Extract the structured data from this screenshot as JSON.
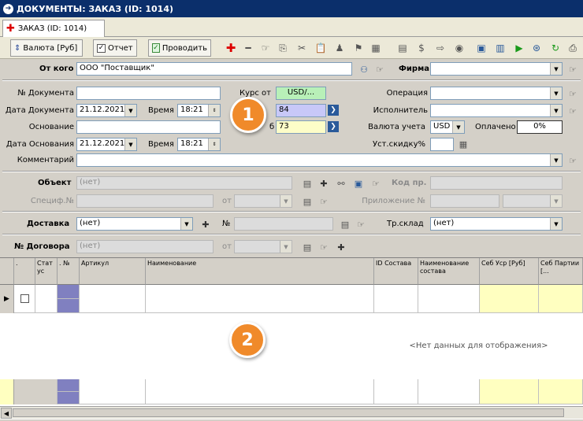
{
  "window": {
    "title": "ДОКУМЕНТЫ: ЗАКАЗ (ID: 1014)"
  },
  "tab": {
    "label": "ЗАКАЗ (ID: 1014)"
  },
  "toolbar": {
    "currency_label": "Валюта [Руб]",
    "report_label": "Отчет",
    "post_label": "Проводить"
  },
  "form": {
    "from_label": "От кого",
    "from_value": "ООО \"Поставщик\"",
    "firm_label": "Фирма",
    "doc_no_label": "№ Документа",
    "rate_from_label": "Курс от",
    "rate_from_value": "USD/...",
    "rate_value_1": "84",
    "rate_value_2": "73",
    "rate_b_label": "б",
    "operation_label": "Операция",
    "doc_date_label": "Дата Документа",
    "doc_date_value": "21.12.2021",
    "time_label": "Время",
    "doc_time_value": "18:21",
    "executor_label": "Исполнитель",
    "basis_label": "Основание",
    "currency_acc_label": "Валюта учета",
    "currency_acc_value": "USD",
    "paid_label": "Оплачено",
    "paid_value": "0%",
    "basis_date_label": "Дата Основания",
    "basis_date_value": "21.12.2021",
    "basis_time_label": "Время",
    "basis_time_value": "18:21",
    "discount_label": "Уст.скидку%",
    "comment_label": "Комментарий",
    "object_label": "Объект",
    "object_value": "(нет)",
    "code_label": "Код пр.",
    "spec_label": "Специф.№",
    "from_small_label": "от",
    "appendix_label": "Приложение №",
    "delivery_label": "Доставка",
    "delivery_value": "(нет)",
    "no_label": "№",
    "warehouse_label": "Тр.склад",
    "warehouse_value": "(нет)",
    "contract_label": "№ Договора",
    "contract_value": "(нет)",
    "contract_from_label": "от"
  },
  "grid": {
    "columns": [
      ".",
      "Стат ус",
      ". №",
      "Артикул",
      "Наименование",
      "ID Состава",
      "Наименование состава",
      "Себ Уср [Руб]",
      "Себ Партии [..."
    ],
    "empty_text": "<Нет данных для отображения>"
  },
  "badges": {
    "one": "1",
    "two": "2"
  },
  "colors": {
    "title_bg": "#0b2f6b",
    "badge": "#f08a2a",
    "rate1_bg": "#c8c8f8",
    "rate2_bg": "#fdfdc8",
    "rate_from_bg": "#b8f0b8",
    "col_purple": "#8080c0",
    "col_yellow": "#ffffc0"
  }
}
